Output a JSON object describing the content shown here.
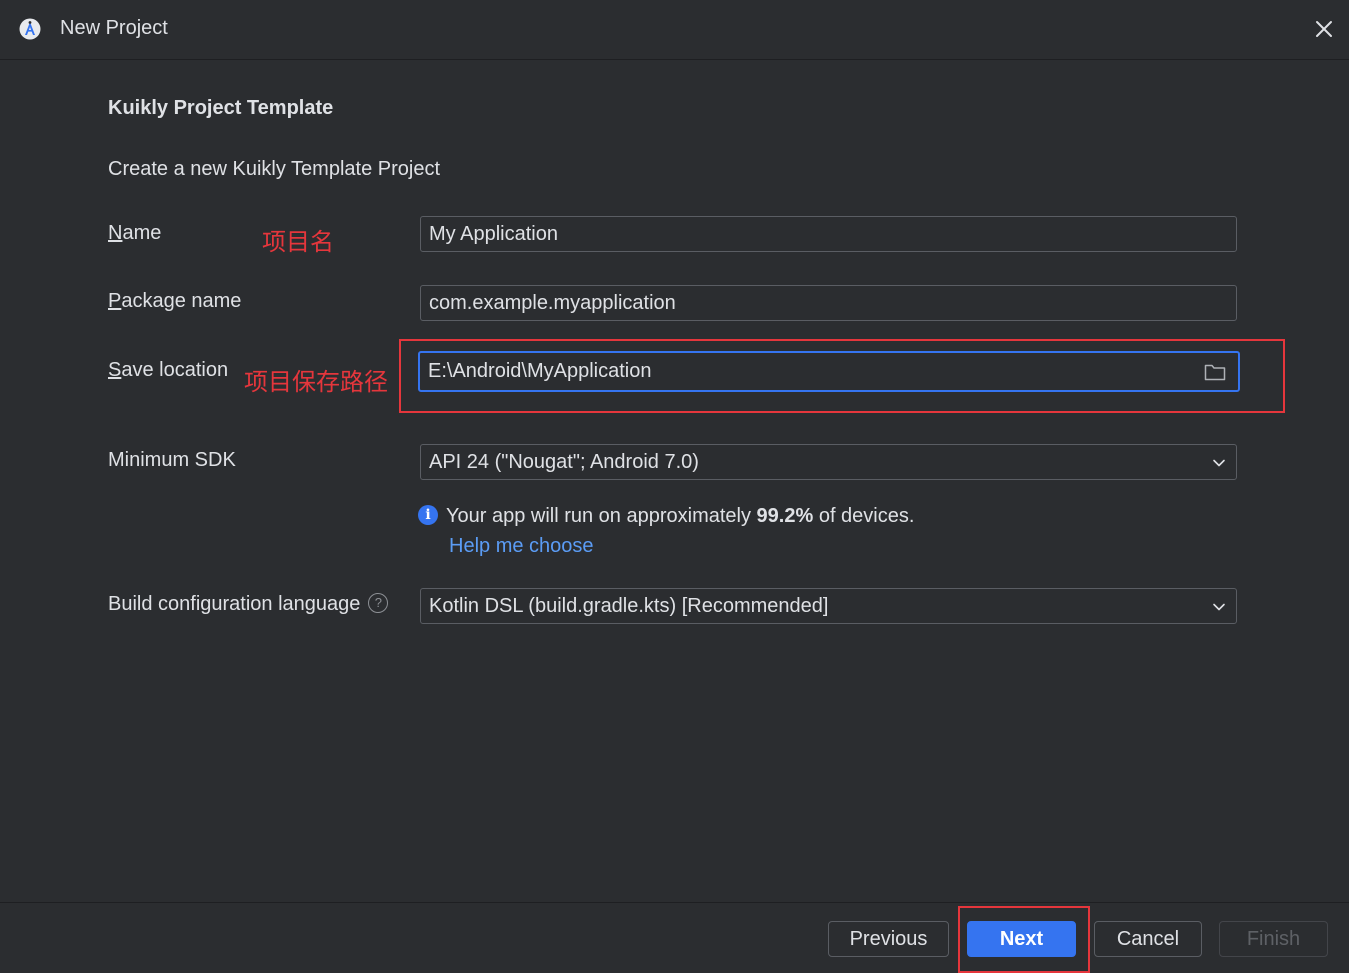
{
  "window": {
    "title": "New Project"
  },
  "template": {
    "heading": "Kuikly Project Template",
    "description": "Create a new Kuikly Template Project"
  },
  "form": {
    "name": {
      "label_mnemonic": "N",
      "label_rest": "ame",
      "value": "My Application",
      "annotation": "项目名"
    },
    "package_name": {
      "label_mnemonic": "P",
      "label_rest": "ackage name",
      "value": "com.example.myapplication"
    },
    "save_location": {
      "label_mnemonic": "S",
      "label_rest": "ave location",
      "value": "E:\\Android\\MyApplication",
      "annotation": "项目保存路径"
    },
    "minimum_sdk": {
      "label": "Minimum SDK",
      "selected": "API 24 (\"Nougat\"; Android 7.0)"
    },
    "sdk_info": {
      "prefix": "Your app will run on approximately ",
      "percent": "99.2%",
      "suffix": " of devices.",
      "help_link": "Help me choose"
    },
    "build_language": {
      "label": "Build configuration language",
      "help_icon": "?",
      "selected": "Kotlin DSL (build.gradle.kts) [Recommended]"
    }
  },
  "footer": {
    "previous": "Previous",
    "next": "Next",
    "cancel": "Cancel",
    "finish": "Finish"
  },
  "icons": {
    "app": "android-studio-icon",
    "close": "close-icon",
    "folder": "folder-icon",
    "dropdown": "chevron-down-icon",
    "info": "info-icon",
    "help": "question-icon"
  },
  "colors": {
    "background": "#2b2d30",
    "accent": "#3574f0",
    "link": "#5b9cf5",
    "annotation": "#e5363c"
  }
}
